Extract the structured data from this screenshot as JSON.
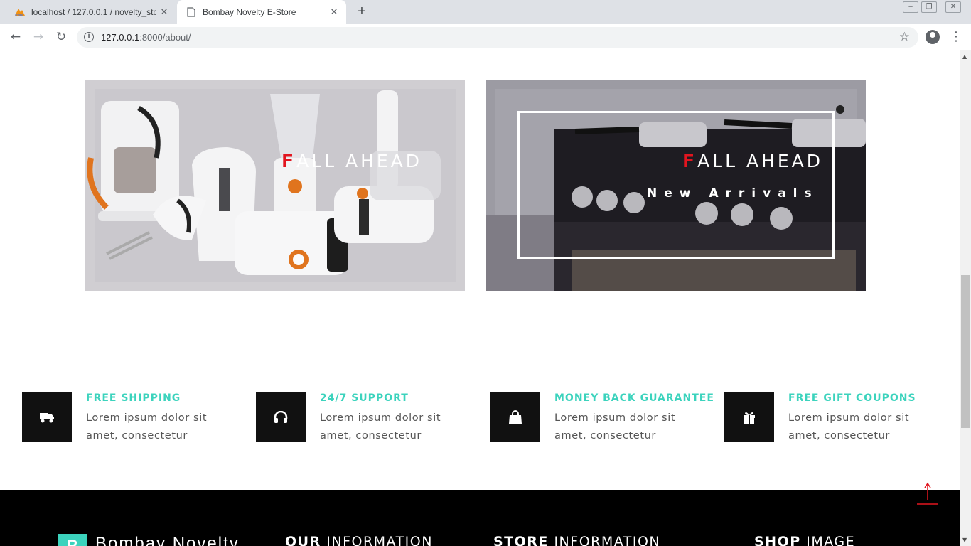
{
  "browser": {
    "tabs": [
      {
        "title": "localhost / 127.0.0.1 / novelty_sto",
        "icon": "phpmyadmin-icon",
        "active": false
      },
      {
        "title": "Bombay Novelty E-Store",
        "icon": "document-icon",
        "active": true
      }
    ],
    "url_host": "127.0.0.1",
    "url_path": ":8000/about/"
  },
  "banners": [
    {
      "headline_first": "F",
      "headline_rest": "ALL AHEAD",
      "subtitle": ""
    },
    {
      "headline_first": "F",
      "headline_rest": "ALL AHEAD",
      "subtitle": "New Arrivals"
    }
  ],
  "features": [
    {
      "title": "FREE SHIPPING",
      "desc": "Lorem ipsum dolor sit amet, consectetur",
      "icon": "truck-icon"
    },
    {
      "title": "24/7 SUPPORT",
      "desc": "Lorem ipsum dolor sit amet, consectetur",
      "icon": "headphones-icon"
    },
    {
      "title": "MONEY BACK GUARANTEE",
      "desc": "Lorem ipsum dolor sit amet, consectetur",
      "icon": "shopping-bag-icon"
    },
    {
      "title": "FREE GIFT COUPONS",
      "desc": "Lorem ipsum dolor sit amet, consectetur",
      "icon": "gift-icon"
    }
  ],
  "footer": {
    "logo_letter": "B",
    "brand": "Bombay Novelty",
    "headings": [
      {
        "bold": "OUR",
        "rest": " INFORMATION"
      },
      {
        "bold": "STORE",
        "rest": " INFORMATION"
      },
      {
        "bold": "SHOP",
        "rest": " IMAGE"
      }
    ]
  },
  "colors": {
    "accent": "#3cd3bd",
    "headline_red": "#e2151f",
    "icon_box": "#111111",
    "footer_bg": "#000000"
  }
}
